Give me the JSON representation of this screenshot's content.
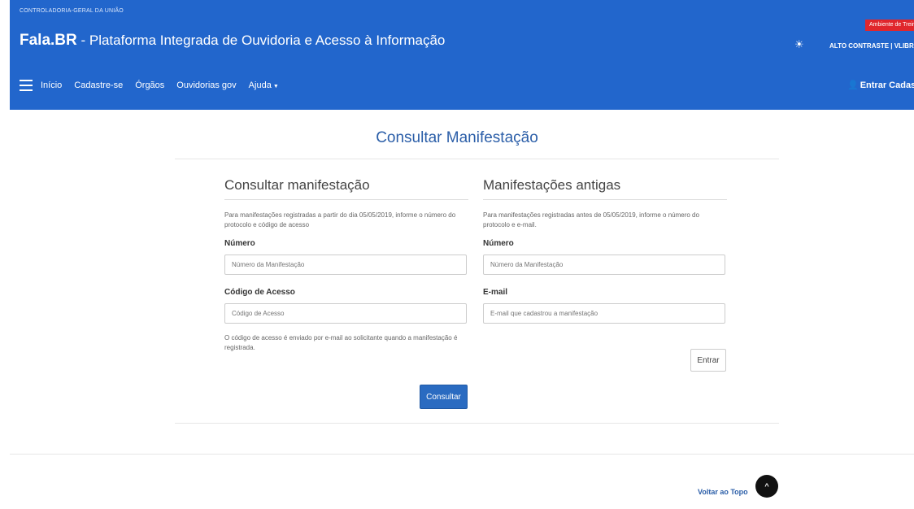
{
  "header": {
    "org": "CONTROLADORIA-GERAL DA UNIÃO",
    "brand_bold": "Fala.BR",
    "brand_rest": " - Plataforma Integrada de Ouvidoria e Acesso à Informação",
    "env_badge": "Ambiente de Treinamento",
    "contrast_label": "ALTO CONTRASTE | VLIBRAS"
  },
  "nav": {
    "items": [
      {
        "label": "Início"
      },
      {
        "label": "Cadastre-se"
      },
      {
        "label": "Órgãos"
      },
      {
        "label": "Ouvidorias gov"
      },
      {
        "label": "Ajuda"
      }
    ],
    "login_label": "Entrar",
    "register_label": "Cadastrar"
  },
  "page": {
    "title": "Consultar Manifestação"
  },
  "left_form": {
    "title": "Consultar manifestação",
    "description": "Para manifestações registradas a partir do dia 05/05/2019, informe o número do protocolo e código de acesso",
    "number_label": "Número",
    "number_placeholder": "Número da Manifestação",
    "code_label": "Código de Acesso",
    "code_placeholder": "Código de Acesso",
    "hint": "O código de acesso é enviado por e-mail ao solicitante quando a manifestação é registrada.",
    "submit_label": "Consultar"
  },
  "right_form": {
    "title": "Manifestações antigas",
    "description": "Para manifestações registradas antes de 05/05/2019, informe o número do protocolo e e-mail.",
    "number_label": "Número",
    "number_placeholder": "Número da Manifestação",
    "email_label": "E-mail",
    "email_placeholder": "E-mail que cadastrou a manifestação",
    "submit_label": "Entrar"
  },
  "footer": {
    "back_to_top": "Voltar ao Topo",
    "arrow": "^"
  }
}
